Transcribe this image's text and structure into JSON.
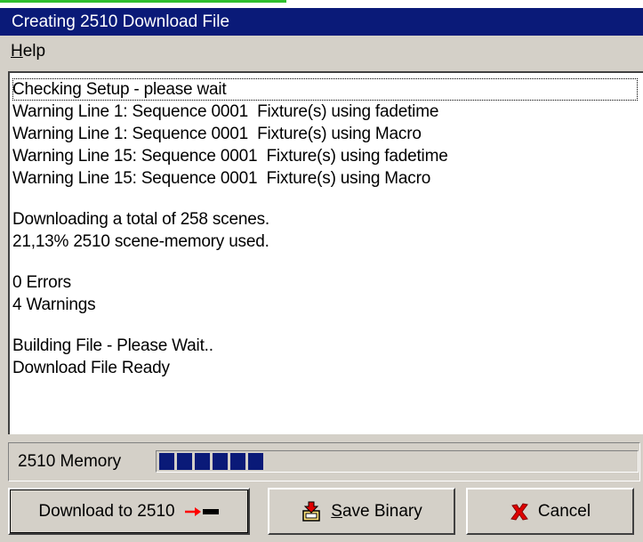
{
  "window": {
    "title": "Creating 2510 Download File"
  },
  "menu": {
    "help_accel": "H",
    "help_rest": "elp"
  },
  "log": {
    "lines": [
      "Checking Setup - please wait",
      "Warning Line 1: Sequence 0001  Fixture(s) using fadetime",
      "Warning Line 1: Sequence 0001  Fixture(s) using Macro",
      "Warning Line 15: Sequence 0001  Fixture(s) using fadetime",
      "Warning Line 15: Sequence 0001  Fixture(s) using Macro",
      "",
      "Downloading a total of 258 scenes.",
      "21,13% 2510 scene-memory used.",
      "",
      "0 Errors",
      "4 Warnings",
      "",
      "Building File - Please Wait..",
      "Download File Ready"
    ]
  },
  "memory": {
    "label": "2510 Memory",
    "used_percent": 21.13,
    "color": "#0a1a78"
  },
  "buttons": {
    "download": {
      "label": "Download to 2510",
      "icon": "arrow-to-device-icon"
    },
    "save": {
      "accel": "S",
      "rest": "ave Binary",
      "icon": "save-binary-icon"
    },
    "cancel": {
      "label": "Cancel",
      "icon": "red-x-icon"
    }
  }
}
